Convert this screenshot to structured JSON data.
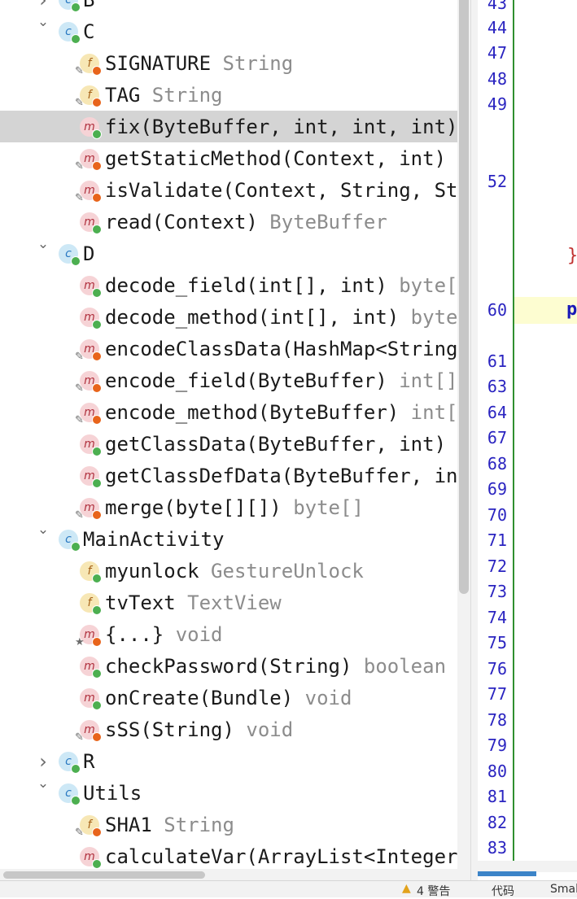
{
  "structure": {
    "rows": [
      {
        "name": "B",
        "kind": "class",
        "expanded": false,
        "depth": 0
      },
      {
        "name": "C",
        "kind": "class",
        "expanded": true,
        "depth": 0
      },
      {
        "name": "SIGNATURE",
        "type": "String",
        "kind": "field",
        "access": "private",
        "depth": 1
      },
      {
        "name": "TAG",
        "type": "String",
        "kind": "field",
        "access": "private",
        "depth": 1
      },
      {
        "name": "fix(ByteBuffer, int, int, int)",
        "kind": "method",
        "access": "public",
        "depth": 1,
        "selected": true
      },
      {
        "name": "getStaticMethod(Context, int)",
        "kind": "method",
        "access": "private",
        "depth": 1
      },
      {
        "name": "isValidate(Context, String, String)",
        "kind": "method",
        "access": "private",
        "depth": 1
      },
      {
        "name": "read(Context)",
        "type": "ByteBuffer",
        "kind": "method",
        "access": "public",
        "depth": 1
      },
      {
        "name": "D",
        "kind": "class",
        "expanded": true,
        "depth": 0
      },
      {
        "name": "decode_field(int[], int)",
        "type": "byte[]",
        "kind": "method",
        "access": "public",
        "depth": 1
      },
      {
        "name": "decode_method(int[], int)",
        "type": "byte[]",
        "kind": "method",
        "access": "public",
        "depth": 1
      },
      {
        "name": "encodeClassData(HashMap<String, Integer>)",
        "kind": "method",
        "access": "private",
        "depth": 1
      },
      {
        "name": "encode_field(ByteBuffer)",
        "type": "int[]",
        "kind": "method",
        "access": "private",
        "depth": 1
      },
      {
        "name": "encode_method(ByteBuffer)",
        "type": "int[]",
        "kind": "method",
        "access": "private",
        "depth": 1
      },
      {
        "name": "getClassData(ByteBuffer, int)",
        "kind": "method",
        "access": "public",
        "depth": 1
      },
      {
        "name": "getClassDefData(ByteBuffer, int)",
        "kind": "method",
        "access": "public",
        "depth": 1
      },
      {
        "name": "merge(byte[][])",
        "type": "byte[]",
        "kind": "method",
        "access": "private",
        "depth": 1
      },
      {
        "name": "MainActivity",
        "kind": "class",
        "expanded": true,
        "depth": 0
      },
      {
        "name": "myunlock",
        "type": "GestureUnlock",
        "kind": "field",
        "access": "public",
        "depth": 1
      },
      {
        "name": "tvText",
        "type": "TextView",
        "kind": "field",
        "access": "public",
        "depth": 1
      },
      {
        "name": "{...}",
        "type": "void",
        "kind": "method",
        "access": "static-init",
        "depth": 1
      },
      {
        "name": "checkPassword(String)",
        "type": "boolean",
        "kind": "method",
        "access": "public",
        "depth": 1
      },
      {
        "name": "onCreate(Bundle)",
        "type": "void",
        "kind": "method",
        "access": "public",
        "depth": 1
      },
      {
        "name": "sSS(String)",
        "type": "void",
        "kind": "method",
        "access": "private",
        "depth": 1
      },
      {
        "name": "R",
        "kind": "class",
        "expanded": false,
        "depth": 0
      },
      {
        "name": "Utils",
        "kind": "class",
        "expanded": true,
        "depth": 0
      },
      {
        "name": "SHA1",
        "type": "String",
        "kind": "field",
        "access": "private",
        "depth": 1
      },
      {
        "name": "calculateVar(ArrayList<Integer>)",
        "kind": "method",
        "access": "public",
        "depth": 1
      }
    ]
  },
  "editor": {
    "line_numbers": [
      "43",
      "44",
      "47",
      "48",
      "49",
      "52",
      "60",
      "61",
      "63",
      "64",
      "67",
      "68",
      "69",
      "70",
      "71",
      "72",
      "73",
      "74",
      "75",
      "76",
      "77",
      "78",
      "79",
      "80",
      "81",
      "82",
      "83"
    ],
    "current_line": "60",
    "visible_tokens": {
      "brace": "}",
      "keyword_start": "p"
    }
  },
  "status_bar": {
    "warnings": "4 警告",
    "code_tab": "代码",
    "smali_tab": "Smali"
  },
  "icons": {
    "class": "class-c-icon",
    "field": "field-f-icon",
    "method": "method-m-icon",
    "expanded": "chevron-down-icon",
    "collapsed": "chevron-right-icon",
    "warning": "warning-triangle-icon"
  },
  "colors": {
    "selected_row": "#d4d4d4",
    "current_line": "#fdfdd1",
    "public_dot": "#4caf50",
    "private_dot": "#e8641b",
    "line_number": "#2a24c0"
  }
}
